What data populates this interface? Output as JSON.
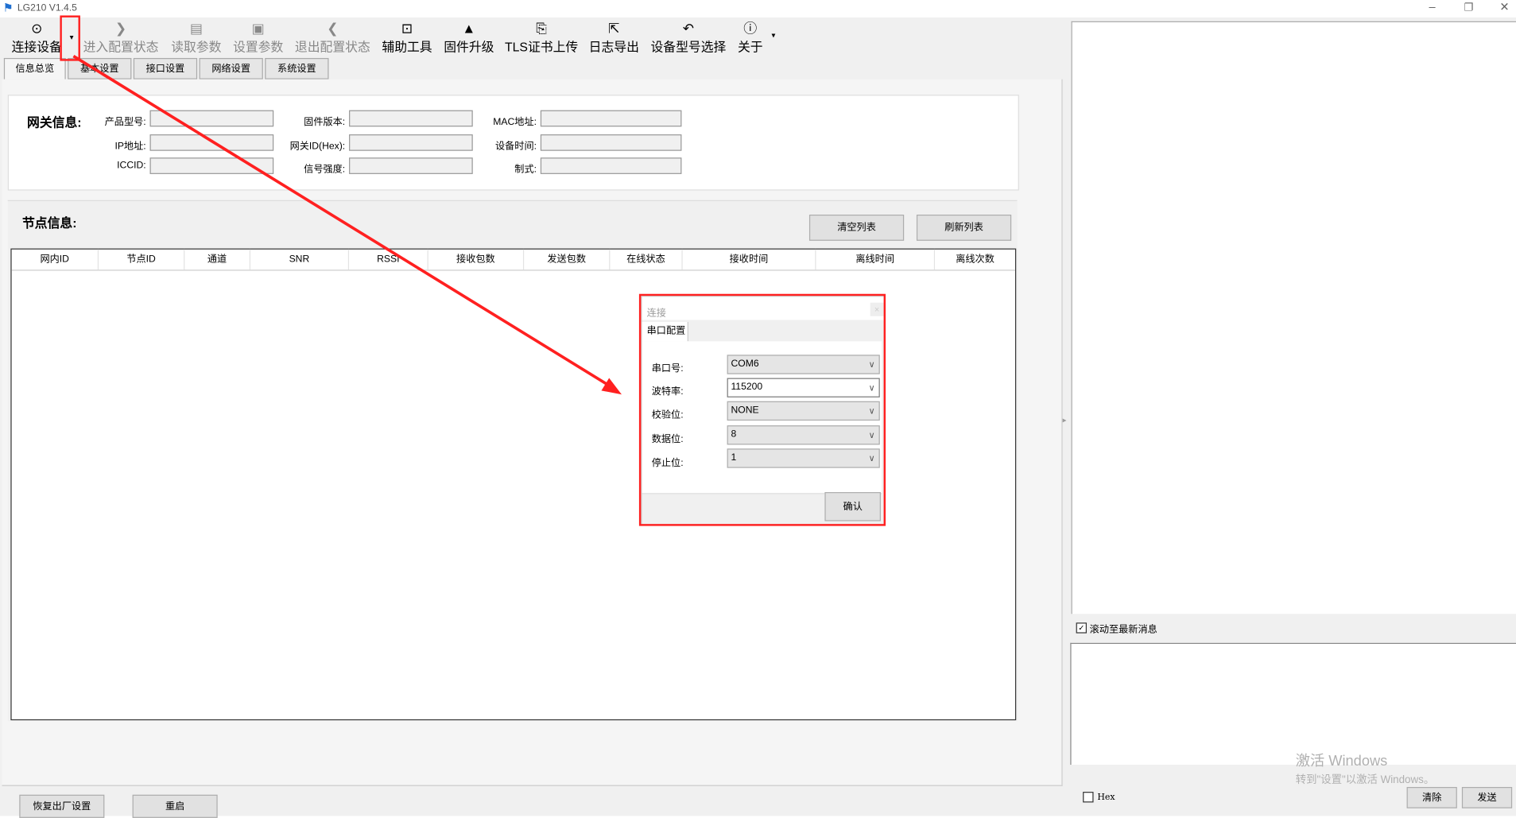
{
  "window": {
    "title": "LG210 V1.4.5"
  },
  "toolbar": {
    "items": [
      {
        "label": "连接设备",
        "icon": "location-check-icon"
      },
      {
        "label": "进入配置状态",
        "icon": "chevron-right-icon"
      },
      {
        "label": "读取参数",
        "icon": "read-doc-icon"
      },
      {
        "label": "设置参数",
        "icon": "save-icon"
      },
      {
        "label": "退出配置状态",
        "icon": "chevron-left-icon"
      },
      {
        "label": "辅助工具",
        "icon": "toolbox-icon"
      },
      {
        "label": "固件升级",
        "icon": "rocket-icon"
      },
      {
        "label": "TLS证书上传",
        "icon": "certificate-icon"
      },
      {
        "label": "日志导出",
        "icon": "export-icon"
      },
      {
        "label": "设备型号选择",
        "icon": "undo-arrow-icon"
      },
      {
        "label": "关于",
        "icon": "info-icon"
      }
    ]
  },
  "tabs": [
    "信息总览",
    "基本设置",
    "接口设置",
    "网络设置",
    "系统设置"
  ],
  "gateway": {
    "title": "网关信息:",
    "fields": [
      {
        "label": "产品型号:",
        "value": ""
      },
      {
        "label": "固件版本:",
        "value": ""
      },
      {
        "label": "MAC地址:",
        "value": ""
      },
      {
        "label": "IP地址:",
        "value": ""
      },
      {
        "label": "网关ID(Hex):",
        "value": ""
      },
      {
        "label": "设备时间:",
        "value": ""
      },
      {
        "label": "ICCID:",
        "value": ""
      },
      {
        "label": "信号强度:",
        "value": ""
      },
      {
        "label": "制式:",
        "value": ""
      }
    ]
  },
  "nodes": {
    "title": "节点信息:",
    "clear_label": "清空列表",
    "refresh_label": "刷新列表",
    "columns": [
      "网内ID",
      "节点ID",
      "通道",
      "SNR",
      "RSSI",
      "接收包数",
      "发送包数",
      "在线状态",
      "接收时间",
      "离线时间",
      "离线次数"
    ],
    "rows": []
  },
  "bottom": {
    "factory_reset": "恢复出厂设置",
    "restart": "重启"
  },
  "right": {
    "autoscroll_label": "滚动至最新消息",
    "autoscroll_checked": true,
    "hex_label": "Hex",
    "hex_checked": false,
    "clear_label": "清除",
    "send_label": "发送"
  },
  "watermark": {
    "line1": "激活 Windows",
    "line2": "转到\"设置\"以激活 Windows。"
  },
  "dialog": {
    "title": "连接",
    "close": "×",
    "tab": "串口配置",
    "fields": [
      {
        "label": "串口号:",
        "value": "COM6"
      },
      {
        "label": "波特率:",
        "value": "115200"
      },
      {
        "label": "校验位:",
        "value": "NONE"
      },
      {
        "label": "数据位:",
        "value": "8"
      },
      {
        "label": "停止位:",
        "value": "1"
      }
    ],
    "confirm": "确认"
  },
  "annotation_color": "#ff2020"
}
